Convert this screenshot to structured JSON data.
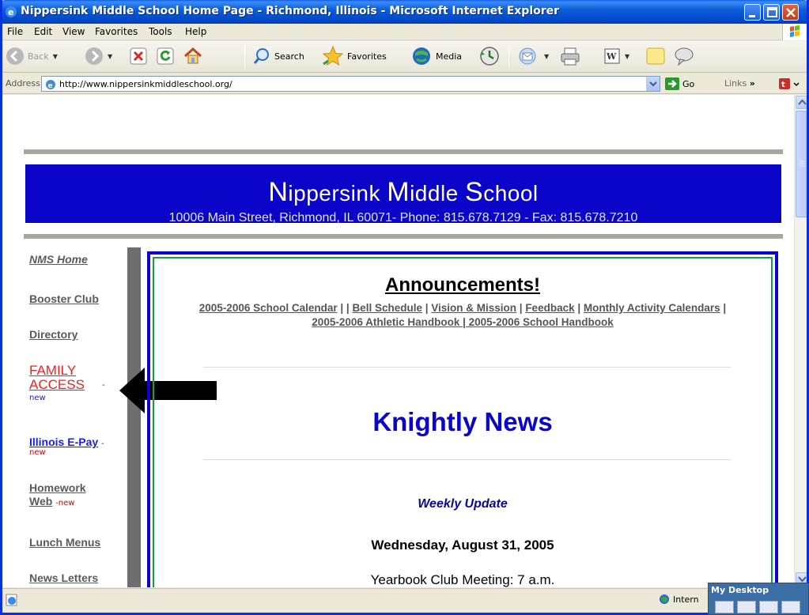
{
  "window": {
    "title": "Nippersink Middle School Home Page - Richmond, Illinois - Microsoft Internet Explorer"
  },
  "menu": [
    "File",
    "Edit",
    "View",
    "Favorites",
    "Tools",
    "Help"
  ],
  "toolbar": {
    "back": "Back",
    "search": "Search",
    "favorites": "Favorites",
    "media": "Media"
  },
  "address": {
    "label": "Address",
    "url": "http://www.nippersinkmiddleschool.org/",
    "go": "Go",
    "links": "Links"
  },
  "banner": {
    "title_words": [
      {
        "initial": "N",
        "rest": "ippersink"
      },
      {
        "initial": "M",
        "rest": "iddle"
      },
      {
        "initial": "S",
        "rest": "chool"
      }
    ],
    "address_line": "10006 Main Street, Richmond, IL 60071- Phone: 815.678.7129 - Fax: 815.678.7210"
  },
  "sidebar": {
    "nms_home": "NMS Home",
    "booster_club": "Booster Club",
    "directory": "Directory",
    "family_access_1": "FAMILY",
    "family_access_2": "ACCESS",
    "dash": "-",
    "new": "new",
    "new_hyphen": "-new",
    "illinois_epay": "Illinois E-Pay",
    "homework_1": "Homework",
    "homework_2": "Web",
    "lunch_menus": "Lunch Menus",
    "news_letters": "News Letters"
  },
  "announcements": {
    "title": "Announcements!",
    "school_calendar": "2005-2006 School Calendar",
    "sep_double": " | | ",
    "bell_schedule": "Bell Schedule",
    "sep": " | ",
    "vision_mission": "Vision & Mission",
    "feedback": "Feedback",
    "monthly_calendars": "Monthly Activity Calendars",
    "sep_end": " |",
    "athletic_handbook": "2005-2006 Athletic Handbook | 2005-2006 School Handbook"
  },
  "news": {
    "heading": "Knightly News",
    "weekly": "Weekly Update",
    "date": "Wednesday, August 31, 2005",
    "item1": "Yearbook Club Meeting: 7 a.m."
  },
  "status": {
    "zone": "Intern"
  },
  "desktop_popup": {
    "title": "My Desktop"
  },
  "colors": {
    "banner_blue": "#0a05c8",
    "family_access_red": "#ff1a1a",
    "frame_green": "#0ca33a"
  }
}
